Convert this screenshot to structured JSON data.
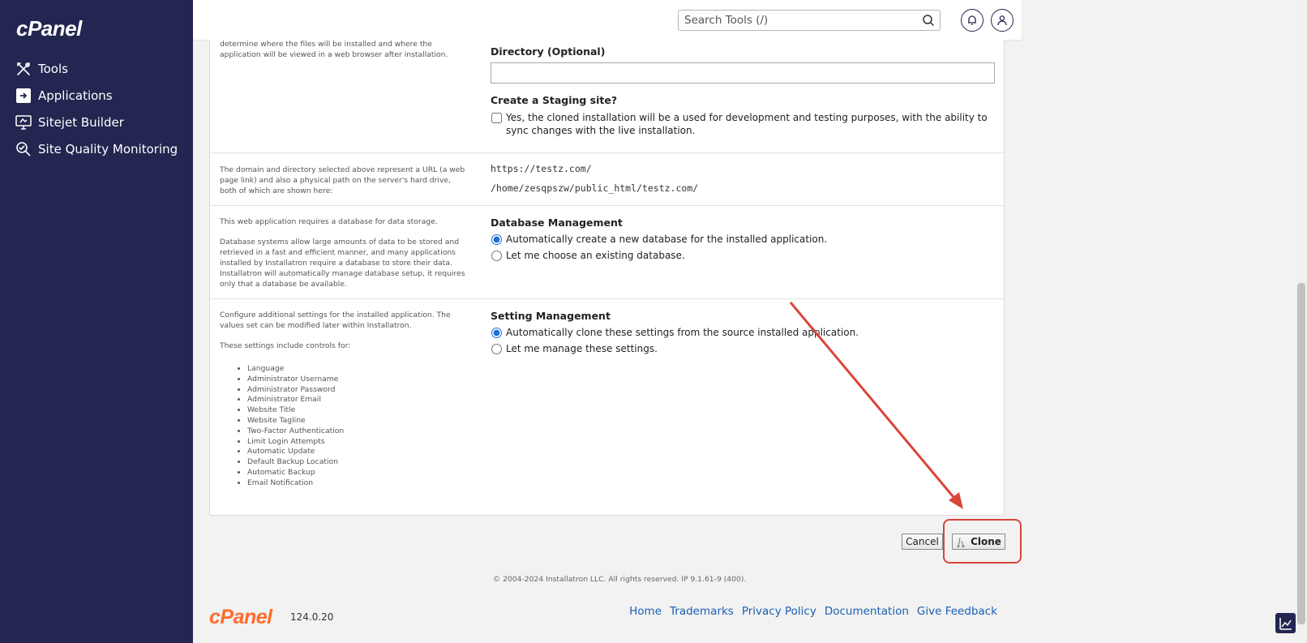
{
  "sidebar": {
    "logo": "cPanel",
    "items": [
      {
        "label": "Tools",
        "icon": "tools-icon"
      },
      {
        "label": "Applications",
        "icon": "applications-icon"
      },
      {
        "label": "Sitejet Builder",
        "icon": "sitejet-icon"
      },
      {
        "label": "Site Quality Monitoring",
        "icon": "site-quality-icon"
      }
    ]
  },
  "header": {
    "search_placeholder": "Search Tools (/)"
  },
  "sections": {
    "location": {
      "help": "determine where the files will be installed and where the application will be viewed in a web browser after installation.",
      "directory_label": "Directory (Optional)",
      "directory_value": "",
      "staging_label": "Create a Staging site?",
      "staging_option": "Yes, the cloned installation will be a used for development and testing purposes, with the ability to sync changes with the live installation.",
      "staging_checked": false
    },
    "url": {
      "help": "The domain and directory selected above represent a URL (a web page link) and also a physical path on the server's hard drive, both of which are shown here:",
      "url": "https://testz.com/",
      "path": "/home/zesqpszw/public_html/testz.com/"
    },
    "database": {
      "help1": "This web application requires a database for data storage.",
      "help2": "Database systems allow large amounts of data to be stored and retrieved in a fast and efficient manner, and many applications installed by Installatron require a database to store their data. Installatron will automatically manage database setup, it requires only that a database be available.",
      "title": "Database Management",
      "option_auto": "Automatically create a new database for the installed application.",
      "option_manual": "Let me choose an existing database.",
      "selected": "auto"
    },
    "settings": {
      "help1": "Configure additional settings for the installed application. The values set can be modified later within Installatron.",
      "help2": "These settings include controls for:",
      "items": [
        "Language",
        "Administrator Username",
        "Administrator Password",
        "Administrator Email",
        "Website Title",
        "Website Tagline",
        "Two-Factor Authentication",
        "Limit Login Attempts",
        "Automatic Update",
        "Default Backup Location",
        "Automatic Backup",
        "Email Notification"
      ],
      "title": "Setting Management",
      "option_auto": "Automatically clone these settings from the source installed application.",
      "option_manual": "Let me manage these settings.",
      "selected": "auto"
    }
  },
  "buttons": {
    "cancel": "Cancel",
    "clone": "Clone"
  },
  "copyright": "© 2004-2024 Installatron LLC. All rights reserved. IP 9.1.61-9 (400).",
  "footer": {
    "logo": "cPanel",
    "version": "124.0.20",
    "links": [
      "Home",
      "Trademarks",
      "Privacy Policy",
      "Documentation",
      "Give Feedback"
    ]
  },
  "colors": {
    "sidebar_bg": "#232651",
    "accent_orange": "#ff6c2c",
    "link": "#1a5fb4",
    "annotation_red": "#d9453a"
  }
}
